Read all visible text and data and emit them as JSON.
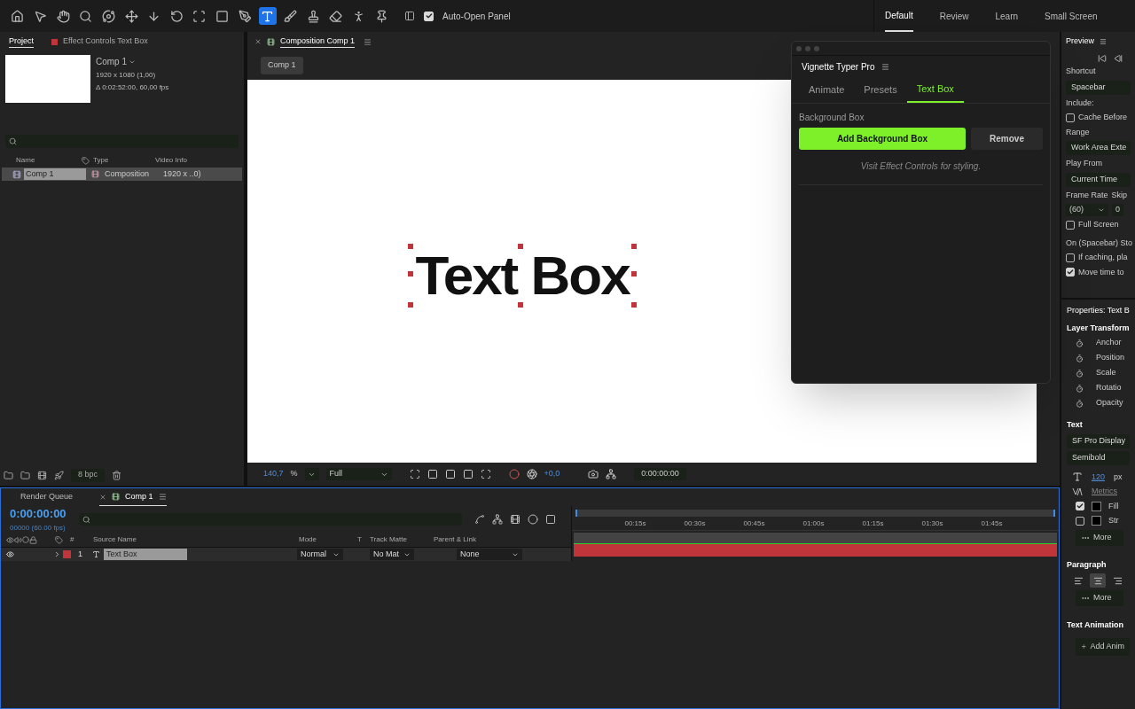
{
  "toolbar": {
    "tools": [
      {
        "kind": "home",
        "selected": false
      },
      {
        "kind": "select",
        "selected": false
      },
      {
        "kind": "hand",
        "selected": false
      },
      {
        "kind": "zoom",
        "selected": false
      },
      {
        "kind": "orbit",
        "selected": false
      },
      {
        "kind": "pan",
        "selected": false
      },
      {
        "kind": "dolly",
        "selected": false
      },
      {
        "kind": "rotate",
        "selected": false
      },
      {
        "kind": "anchor",
        "selected": false
      },
      {
        "kind": "shape",
        "selected": false
      },
      {
        "kind": "pen",
        "selected": false
      },
      {
        "kind": "type",
        "selected": true
      },
      {
        "kind": "brush",
        "selected": false
      },
      {
        "kind": "stamp",
        "selected": false
      },
      {
        "kind": "eraser",
        "selected": false
      },
      {
        "kind": "roto",
        "selected": false
      },
      {
        "kind": "pin",
        "selected": false
      }
    ],
    "auto_open": {
      "label": "Auto-Open Panel",
      "checked": true
    }
  },
  "workspaces": [
    {
      "label": "Default",
      "selected": true
    },
    {
      "label": "Review",
      "selected": false
    },
    {
      "label": "Learn",
      "selected": false
    },
    {
      "label": "Small Screen",
      "selected": false
    }
  ],
  "project_panel": {
    "tabs": [
      {
        "label": "Project",
        "selected": true
      },
      {
        "label": "Effect Controls Text Box",
        "selected": false
      }
    ],
    "comp_name": "Comp 1",
    "details": [
      "1920 x 1080 (1,00)",
      "Δ 0:02:52:00, 60,00 fps"
    ],
    "columns": [
      "Name",
      "Type",
      "Video Info"
    ],
    "rows": [
      {
        "name": "Comp 1",
        "type": "Composition",
        "video_info": "1920 x ..0)",
        "selected": true
      }
    ],
    "bit_depth": "8 bpc"
  },
  "viewer": {
    "tab": "Composition Comp 1",
    "breadcrumb": "Comp 1",
    "canvas_text": "Text Box",
    "zoom": "140,7",
    "zoom_unit": "%",
    "resolution": "Full",
    "exposure": "+0,0",
    "timecode": "0:00:00:00"
  },
  "plugin": {
    "title": "Vignette Typer Pro",
    "tabs": [
      {
        "label": "Animate",
        "selected": false
      },
      {
        "label": "Presets",
        "selected": false
      },
      {
        "label": "Text Box",
        "selected": true
      }
    ],
    "section": "Background Box",
    "primary_button": "Add Background Box",
    "secondary_button": "Remove",
    "hint": "Visit Effect Controls for styling."
  },
  "timeline": {
    "tabs": [
      {
        "label": "Render Queue",
        "selected": false
      },
      {
        "label": "Comp 1",
        "selected": true
      }
    ],
    "timecode": "0:00:00:00",
    "frame_info": "00000 (60.00 fps)",
    "columns": {
      "number": "#",
      "source": "Source Name",
      "mode": "Mode",
      "t": "T",
      "matte": "Track Matte",
      "parent": "Parent & Link"
    },
    "ruler": [
      "00:15s",
      "00:30s",
      "00:45s",
      "01:00s",
      "01:15s",
      "01:30s",
      "01:45s"
    ],
    "layers": [
      {
        "number": "1",
        "name": "Text Box",
        "mode": "Normal",
        "matte": "No Mat",
        "parent": "None",
        "color": "#c0353a",
        "visible": true
      }
    ]
  },
  "preview": {
    "title": "Preview",
    "shortcut_label": "Shortcut",
    "shortcut": "Spacebar",
    "include_label": "Include:",
    "cache": {
      "label": "Cache Before",
      "checked": false
    },
    "range_label": "Range",
    "range": "Work Area Exte",
    "play_from_label": "Play From",
    "play_from": "Current Time",
    "frame_rate_label": "Frame Rate",
    "skip_label": "Skip",
    "frame_rate": "(60)",
    "skip": "0",
    "full_screen": {
      "label": "Full Screen",
      "checked": false
    },
    "stop_label": "On (Spacebar) Sto",
    "if_caching": {
      "label": "If caching, pla",
      "checked": false
    },
    "move_time": {
      "label": "Move time to",
      "checked": true
    }
  },
  "properties": {
    "title": "Properties: Text B",
    "transform_label": "Layer Transform",
    "transform": [
      "Anchor",
      "Position",
      "Scale",
      "Rotatio",
      "Opacity"
    ],
    "text_label": "Text",
    "font": "SF Pro Display",
    "style": "Semibold",
    "size": "120",
    "size_unit": "px",
    "tracking": "Metrics",
    "fill": {
      "label": "Fill",
      "checked": true
    },
    "stroke": {
      "label": "Str",
      "checked": false
    },
    "more": "More",
    "paragraph_label": "Paragraph",
    "alignments": [
      {
        "kind": "left",
        "selected": false
      },
      {
        "kind": "center",
        "selected": true
      },
      {
        "kind": "right",
        "selected": false
      }
    ],
    "paragraph_more": "More",
    "animation_label": "Text Animation",
    "add_animator": "Add Anim"
  }
}
